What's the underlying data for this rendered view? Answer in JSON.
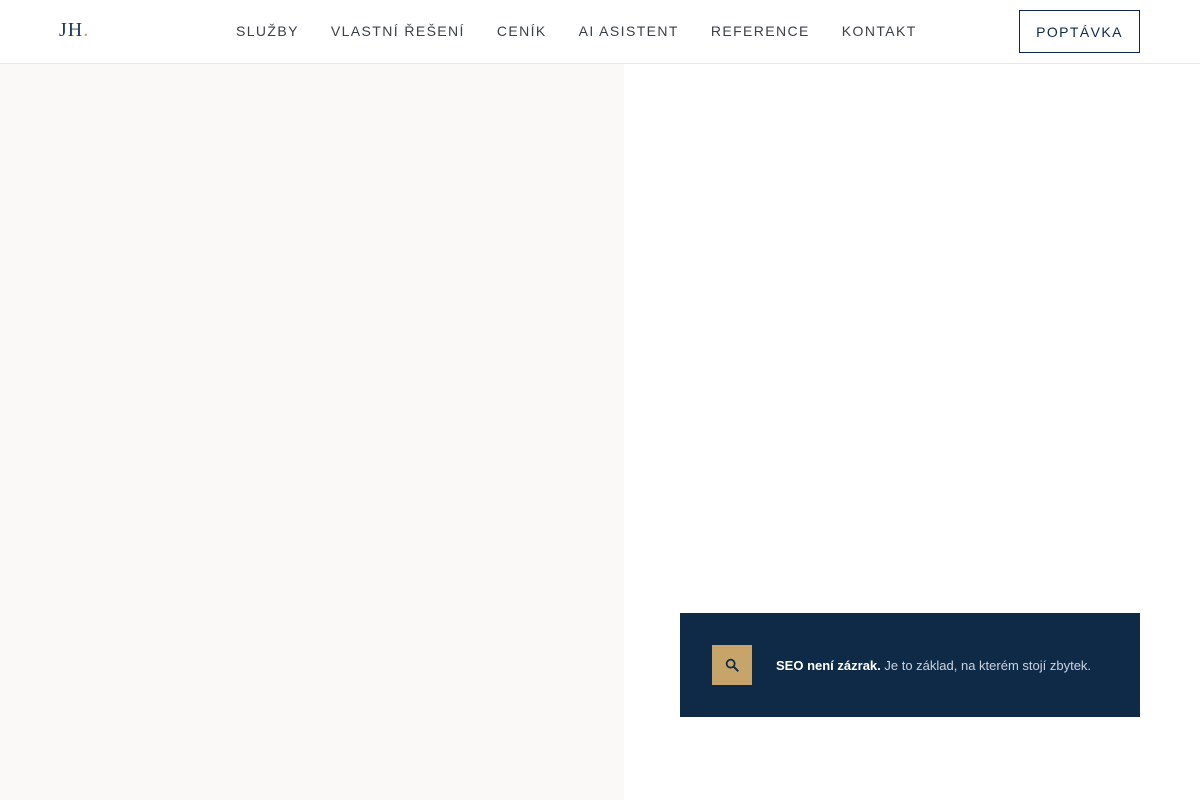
{
  "header": {
    "logo_text": "JH",
    "logo_dot": ".",
    "nav": [
      {
        "label": "SLUŽBY"
      },
      {
        "label": "VLASTNÍ ŘEŠENÍ"
      },
      {
        "label": "CENÍK"
      },
      {
        "label": "AI ASISTENT"
      },
      {
        "label": "REFERENCE"
      },
      {
        "label": "KONTAKT"
      }
    ],
    "cta_label": "POPTÁVKA"
  },
  "seo_card": {
    "icon": "search-icon",
    "headline": "SEO není zázrak.",
    "body": "Je to základ, na kterém stojí zbytek."
  },
  "colors": {
    "navy": "#0e2a47",
    "gold": "#c7a46a",
    "left_panel_bg": "#faf9f7"
  }
}
